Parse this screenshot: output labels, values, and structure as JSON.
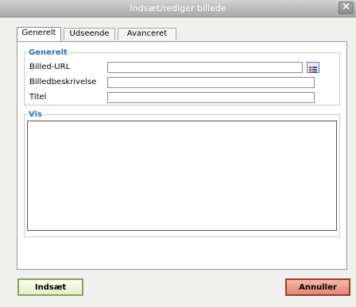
{
  "window": {
    "title": "Indsæt/rediger billede",
    "close_label": "×"
  },
  "tabs": [
    {
      "label": "Generelt",
      "active": true
    },
    {
      "label": "Udseende",
      "active": false
    },
    {
      "label": "Avanceret",
      "active": false
    }
  ],
  "general_section": {
    "legend": "Generelt",
    "fields": {
      "image_url": {
        "label": "Billed-URL",
        "value": ""
      },
      "image_description": {
        "label": "Billedbeskrivelse",
        "value": ""
      },
      "title": {
        "label": "Titel",
        "value": ""
      }
    }
  },
  "preview_section": {
    "legend": "Vis"
  },
  "buttons": {
    "insert_label": "Indsæt",
    "cancel_label": "Annuller"
  },
  "colors": {
    "legend_blue": "#2b6fb6",
    "insert_border": "#84a65c",
    "cancel_fill": "#e08877"
  }
}
